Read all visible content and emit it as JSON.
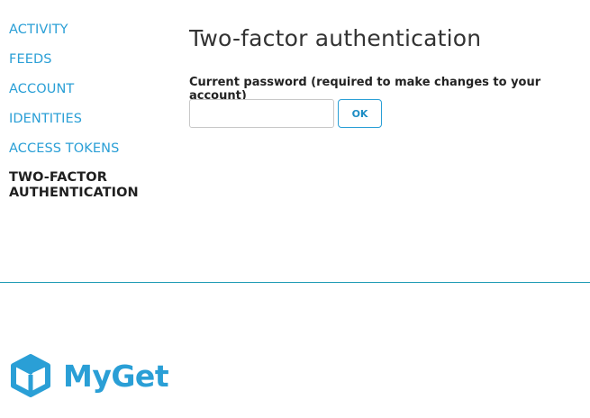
{
  "sidebar": {
    "items": [
      {
        "label": "ACTIVITY"
      },
      {
        "label": "FEEDS"
      },
      {
        "label": "ACCOUNT"
      },
      {
        "label": "IDENTITIES"
      },
      {
        "label": "ACCESS TOKENS"
      },
      {
        "label": "TWO-FACTOR AUTHENTICATION",
        "active": true
      }
    ]
  },
  "main": {
    "title": "Two-factor authentication",
    "password_label": "Current password (required to make changes to your account)",
    "password_value": "",
    "ok_label": "OK"
  },
  "footer": {
    "logo_text": "MyGet"
  },
  "colors": {
    "accent": "#2a9fd6",
    "divider": "#1f9bb5",
    "active_text": "#1f1f1f"
  }
}
